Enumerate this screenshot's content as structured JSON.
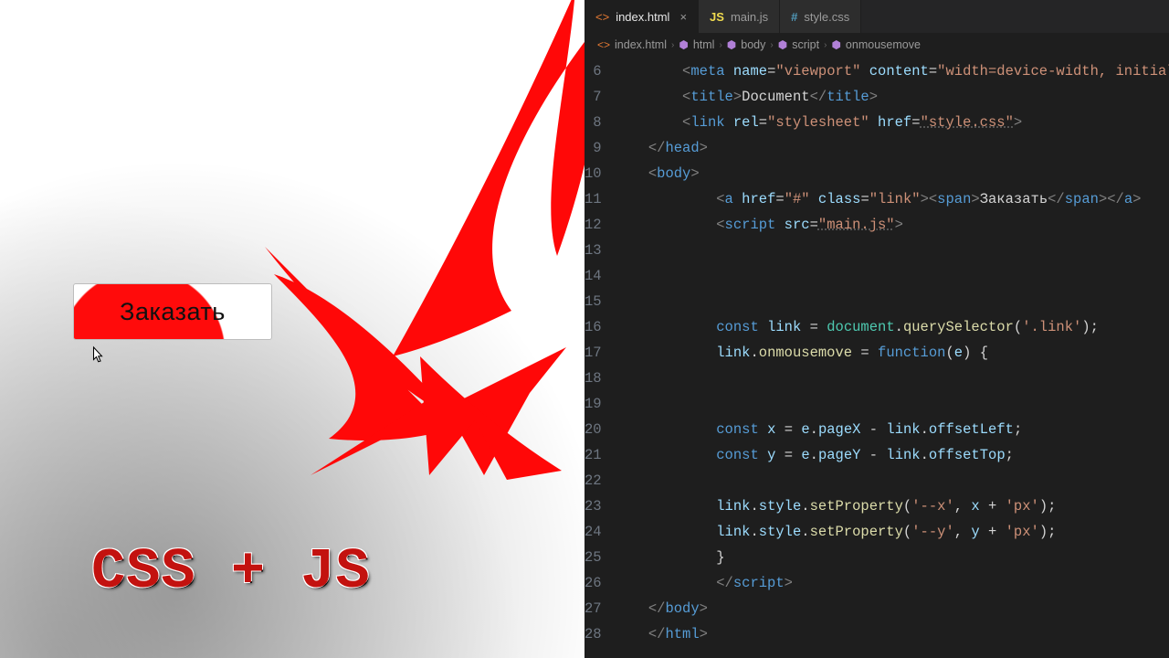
{
  "left": {
    "button_label": "Заказать",
    "headline": "CSS + JS"
  },
  "editor": {
    "tabs": [
      {
        "label": "index.html",
        "kind": "html",
        "active": true,
        "closable": true
      },
      {
        "label": "main.js",
        "kind": "js",
        "active": false,
        "closable": false
      },
      {
        "label": "style.css",
        "kind": "css",
        "active": false,
        "closable": false
      }
    ],
    "breadcrumb": {
      "file": "index.html",
      "parts": [
        "html",
        "body",
        "script",
        "onmousemove"
      ]
    },
    "lines": {
      "6": {
        "indent": 2,
        "html": "<span class='p'>&lt;</span><span class='tg'>meta</span> <span class='at'>name</span><span class='op'>=</span><span class='st'>\"viewport\"</span> <span class='at'>content</span><span class='op'>=</span><span class='st'>\"width=device-width, initial-</span>"
      },
      "7": {
        "indent": 2,
        "html": "<span class='p'>&lt;</span><span class='tg'>title</span><span class='p'>&gt;</span><span class='tx'>Document</span><span class='p'>&lt;/</span><span class='tg'>title</span><span class='p'>&gt;</span>"
      },
      "8": {
        "indent": 2,
        "html": "<span class='p'>&lt;</span><span class='tg'>link</span> <span class='at'>rel</span><span class='op'>=</span><span class='st'>\"stylesheet\"</span> <span class='at'>href</span><span class='op'>=</span><span class='st ul'>\"style.css\"</span><span class='p'>&gt;</span>"
      },
      "9": {
        "indent": 1,
        "html": "<span class='p'>&lt;/</span><span class='tg'>head</span><span class='p'>&gt;</span>"
      },
      "10": {
        "indent": 1,
        "html": "<span class='p'>&lt;</span><span class='tg'>body</span><span class='p'>&gt;</span>"
      },
      "11": {
        "indent": 3,
        "html": "<span class='p'>&lt;</span><span class='tg'>a</span> <span class='at'>href</span><span class='op'>=</span><span class='st'>\"#\"</span> <span class='at'>class</span><span class='op'>=</span><span class='st'>\"link\"</span><span class='p'>&gt;&lt;</span><span class='tg'>span</span><span class='p'>&gt;</span><span class='tx'>Заказать</span><span class='p'>&lt;/</span><span class='tg'>span</span><span class='p'>&gt;&lt;/</span><span class='tg'>a</span><span class='p'>&gt;</span>"
      },
      "12": {
        "indent": 3,
        "html": "<span class='p'>&lt;</span><span class='tg'>script</span> <span class='at'>src</span><span class='op'>=</span><span class='st ul'>\"main.js\"</span><span class='p'>&gt;</span>"
      },
      "13": {
        "indent": 0,
        "html": ""
      },
      "14": {
        "indent": 0,
        "html": ""
      },
      "15": {
        "indent": 0,
        "html": ""
      },
      "16": {
        "indent": 3,
        "html": "<span class='kw'>const</span> <span class='vr'>link</span> <span class='op'>=</span> <span class='ob'>document</span><span class='op'>.</span><span class='fn'>querySelector</span><span class='br'>(</span><span class='st'>'.link'</span><span class='br'>);</span>"
      },
      "17": {
        "indent": 3,
        "html": "<span class='vr'>link</span><span class='op'>.</span><span class='fn'>onmousemove</span> <span class='op'>=</span> <span class='kw'>function</span><span class='br'>(</span><span class='vr'>e</span><span class='br'>)</span> <span class='br'>{</span>"
      },
      "18": {
        "indent": 0,
        "html": ""
      },
      "19": {
        "indent": 0,
        "html": ""
      },
      "20": {
        "indent": 3,
        "html": "<span class='kw'>const</span> <span class='vr'>x</span> <span class='op'>=</span> <span class='vr'>e</span><span class='op'>.</span><span class='vr'>pageX</span> <span class='op'>-</span> <span class='vr'>link</span><span class='op'>.</span><span class='vr'>offsetLeft</span><span class='br'>;</span>"
      },
      "21": {
        "indent": 3,
        "html": "<span class='kw'>const</span> <span class='vr'>y</span> <span class='op'>=</span> <span class='vr'>e</span><span class='op'>.</span><span class='vr'>pageY</span> <span class='op'>-</span> <span class='vr'>link</span><span class='op'>.</span><span class='vr'>offsetTop</span><span class='br'>;</span>"
      },
      "22": {
        "indent": 0,
        "html": ""
      },
      "23": {
        "indent": 3,
        "html": "<span class='vr'>link</span><span class='op'>.</span><span class='vr'>style</span><span class='op'>.</span><span class='fn'>setProperty</span><span class='br'>(</span><span class='st'>'--x'</span><span class='op'>,</span> <span class='vr'>x</span> <span class='op'>+</span> <span class='st'>'px'</span><span class='br'>);</span>"
      },
      "24": {
        "indent": 3,
        "html": "<span class='vr'>link</span><span class='op'>.</span><span class='vr'>style</span><span class='op'>.</span><span class='fn'>setProperty</span><span class='br'>(</span><span class='st'>'--y'</span><span class='op'>,</span> <span class='vr'>y</span> <span class='op'>+</span> <span class='st'>'px'</span><span class='br'>);</span>"
      },
      "25": {
        "indent": 3,
        "html": "<span class='br'>}</span>"
      },
      "26": {
        "indent": 3,
        "html": "<span class='p'>&lt;/</span><span class='tg'>script</span><span class='p'>&gt;</span>"
      },
      "27": {
        "indent": 1,
        "html": "<span class='p'>&lt;/</span><span class='tg'>body</span><span class='p'>&gt;</span>"
      },
      "28": {
        "indent": 1,
        "html": "<span class='p'>&lt;/</span><span class='tg'>html</span><span class='p'>&gt;</span>"
      }
    },
    "line_start": 6,
    "line_end": 28
  }
}
